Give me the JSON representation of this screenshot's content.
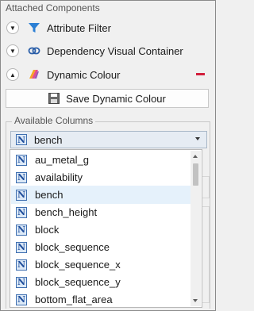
{
  "panel": {
    "section_title": "Attached Components",
    "components": [
      {
        "label": "Attribute Filter",
        "icon": "funnel-icon",
        "toggle": "▼"
      },
      {
        "label": "Dependency Visual Container",
        "icon": "link-icon",
        "toggle": "▼"
      },
      {
        "label": "Dynamic Colour",
        "icon": "paint-icon",
        "toggle": "▲"
      }
    ],
    "save_button_label": "Save Dynamic Colour"
  },
  "available_columns": {
    "legend": "Available Columns",
    "selected_value": "bench",
    "items": [
      "au_metal_g",
      "availability",
      "bench",
      "bench_height",
      "block",
      "block_sequence",
      "block_sequence_x",
      "block_sequence_y",
      "bottom_flat_area"
    ],
    "highlighted_item": "bench"
  },
  "colors": {
    "remove_accent": "#d21f3c",
    "selection_bg": "#e5f1fb",
    "combo_bg": "#e6ecf3",
    "column_icon_border": "#3f6fb0"
  }
}
